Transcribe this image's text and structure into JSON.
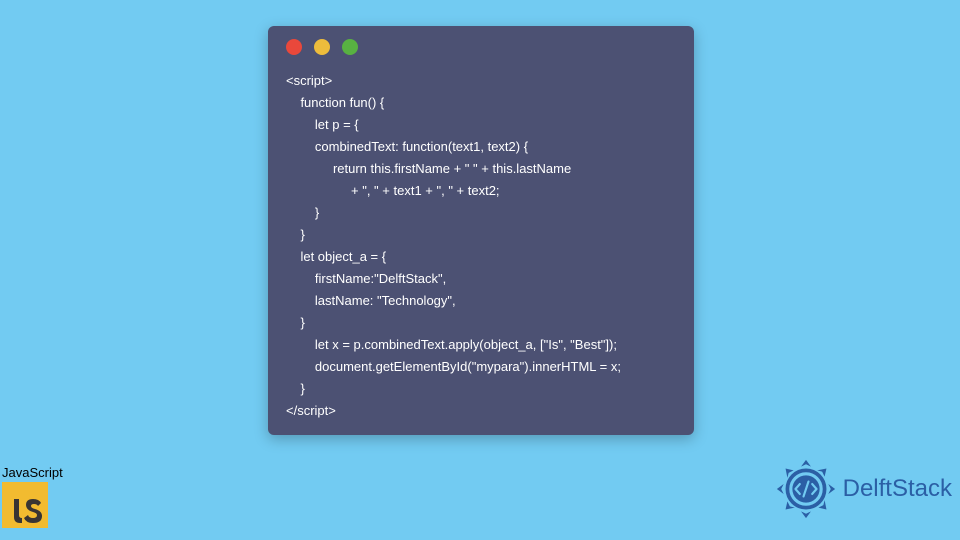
{
  "window": {
    "dots": [
      "red",
      "yellow",
      "green"
    ]
  },
  "code_lines": [
    "<script>",
    "    function fun() {",
    "        let p = {",
    "        combinedText: function(text1, text2) {",
    "             return this.firstName + \" \" + this.lastName",
    "                  + \", \" + text1 + \", \" + text2;",
    "        }",
    "    }",
    "    let object_a = {",
    "        firstName:\"DelftStack\",",
    "        lastName: \"Technology\",",
    "    }",
    "        let x = p.combinedText.apply(object_a, [\"Is\", \"Best\"]);",
    "        document.getElementById(\"mypara\").innerHTML = x;",
    "    }",
    "</script>"
  ],
  "badges": {
    "js_label": "JavaScript",
    "js_letters": "JS",
    "delft_text": "DelftStack"
  },
  "colors": {
    "bg": "#72cbf2",
    "window": "#4c5173",
    "js": "#f2bb30",
    "delft": "#2b5fa5"
  }
}
